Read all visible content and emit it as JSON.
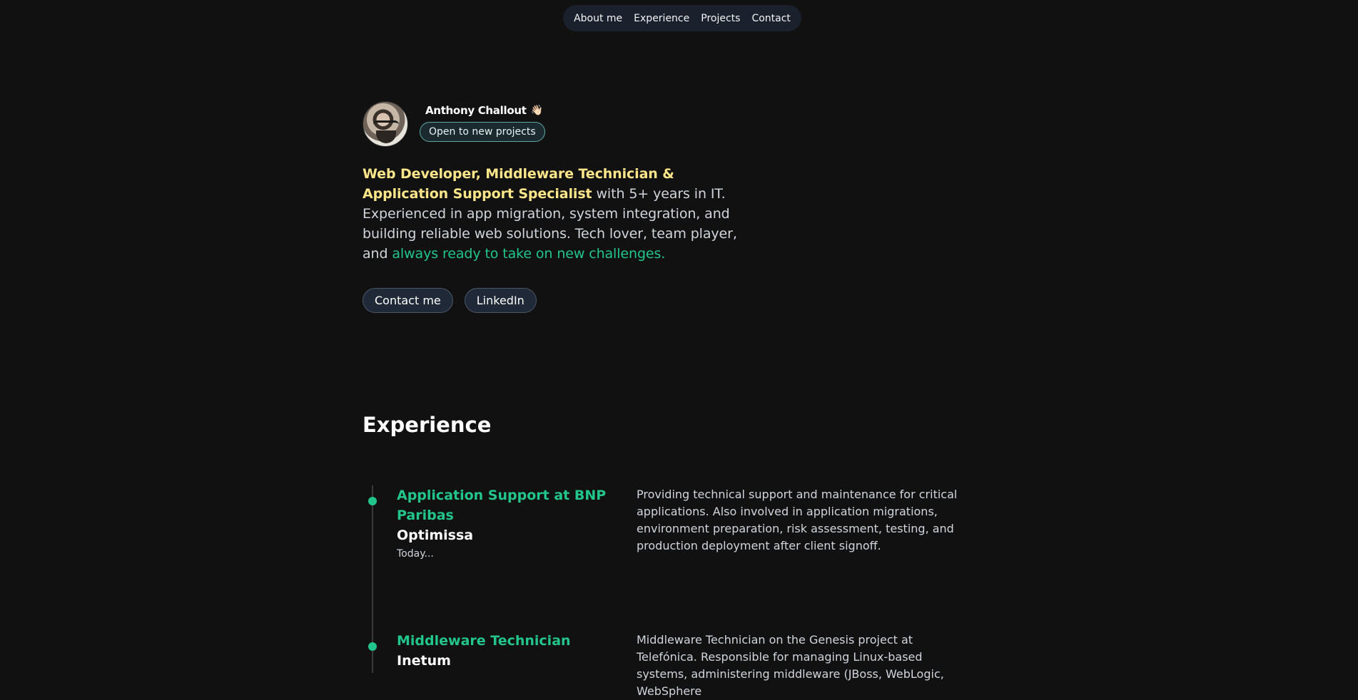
{
  "nav": {
    "items": [
      {
        "label": "About me"
      },
      {
        "label": "Experience"
      },
      {
        "label": "Projects"
      },
      {
        "label": "Contact"
      }
    ]
  },
  "profile": {
    "name": "Anthony Challout",
    "wave_emoji": "👋🏻",
    "status_badge": "Open to new projects"
  },
  "intro": {
    "highlight_roles": "Web Developer, Middleware Technician & Application Support Specialist",
    "text_middle": " with 5+ years in IT. Experienced in app migration, system integration, and building reliable web solutions. Tech lover, team player, and ",
    "highlight_end": "always ready to take on new challenges."
  },
  "actions": {
    "contact_label": "Contact me",
    "linkedin_label": "LinkedIn"
  },
  "experience": {
    "title": "Experience",
    "items": [
      {
        "role": "Application Support at BNP Paribas",
        "company": "Optimissa",
        "date": "Today...",
        "description": "Providing technical support and maintenance for critical applications. Also involved in application migrations, environment preparation, risk assessment, testing, and production deployment after client signoff."
      },
      {
        "role": "Middleware Technician",
        "company": "Inetum",
        "date": "",
        "description": "Middleware Technician on the Genesis project at Telefónica. Responsible for managing Linux-based systems, administering middleware (JBoss, WebLogic, WebSphere"
      }
    ]
  },
  "colors": {
    "background": "#111111",
    "accent_green": "#22c58b",
    "accent_yellow": "#fde68a",
    "nav_bg": "#1a202c"
  }
}
